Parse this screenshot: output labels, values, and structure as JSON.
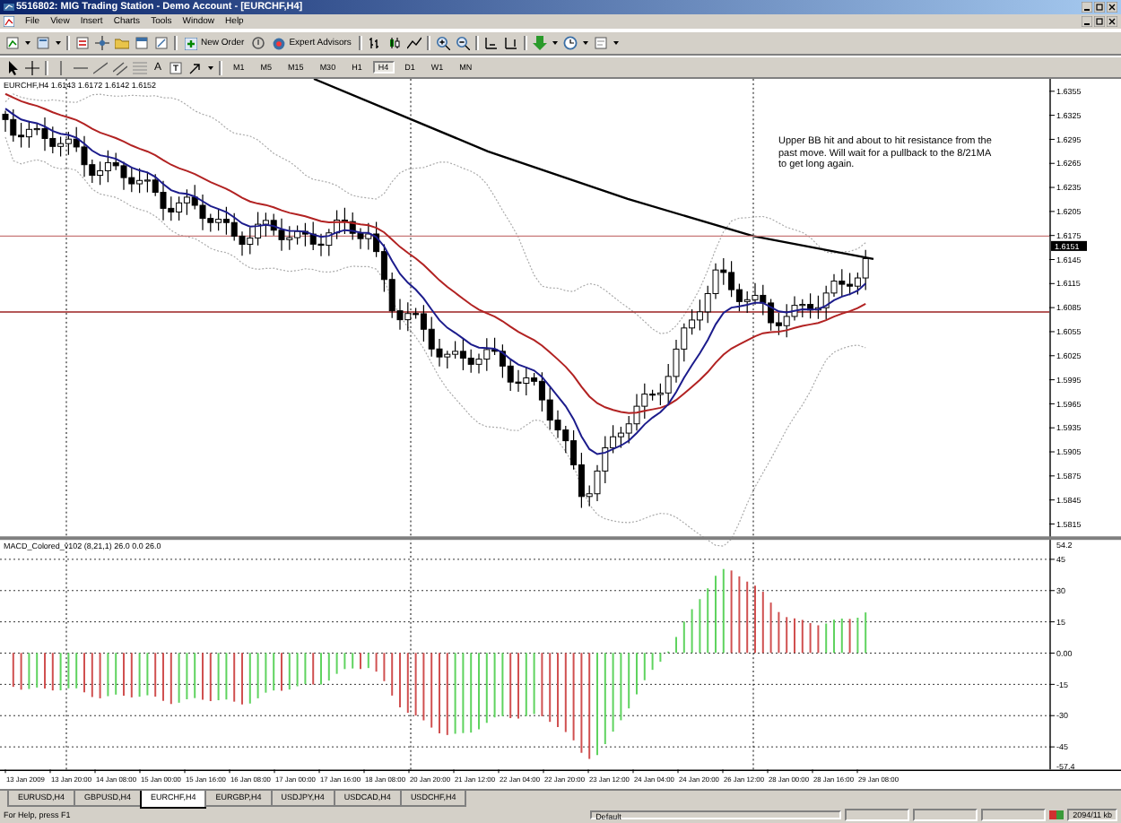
{
  "window": {
    "title": "5516802: MIG Trading Station - Demo Account - [EURCHF,H4]"
  },
  "menu": [
    "File",
    "View",
    "Insert",
    "Charts",
    "Tools",
    "Window",
    "Help"
  ],
  "toolbar": {
    "buttons": [
      {
        "label": "New Order"
      },
      {
        "label": "Expert Advisors"
      }
    ],
    "text_tool": "A",
    "timeframes": [
      {
        "label": "M1",
        "selected": false
      },
      {
        "label": "M5",
        "selected": false
      },
      {
        "label": "M15",
        "selected": false
      },
      {
        "label": "M30",
        "selected": false
      },
      {
        "label": "H1",
        "selected": false
      },
      {
        "label": "H4",
        "selected": true
      },
      {
        "label": "D1",
        "selected": false
      },
      {
        "label": "W1",
        "selected": false
      },
      {
        "label": "MN",
        "selected": false
      }
    ]
  },
  "chart": {
    "symbol_label": "EURCHF,H4 1.6143 1.6172 1.6142 1.6152",
    "annotation": "Upper BB hit and about to hit resistance from the past move. Will wait for a pullback to the 8/21MA to get long again.",
    "price_ticks": [
      "1.6355",
      "1.6325",
      "1.6295",
      "1.6265",
      "1.6235",
      "1.6205",
      "1.6175",
      "1.6145",
      "1.6115",
      "1.6085",
      "1.6055",
      "1.6025",
      "1.5995",
      "1.5965",
      "1.5935",
      "1.5905",
      "1.5875",
      "1.5845",
      "1.5815"
    ],
    "current_price": "1.6151",
    "indicator_label": "MACD_Colored_v102 (8,21,1) 26.0 0.0 26.0",
    "indicator_ticks": [
      "54.2",
      "45",
      "30",
      "15",
      "0.00",
      "-15",
      "-30",
      "-45",
      "-57.4"
    ],
    "time_ticks": [
      "13 Jan 2009",
      "13 Jan 20:00",
      "14 Jan 08:00",
      "15 Jan 00:00",
      "15 Jan 16:00",
      "16 Jan 08:00",
      "17 Jan 00:00",
      "17 Jan 16:00",
      "18 Jan 08:00",
      "20 Jan 20:00",
      "21 Jan 12:00",
      "22 Jan 04:00",
      "22 Jan 20:00",
      "23 Jan 12:00",
      "24 Jan 04:00",
      "24 Jan 20:00",
      "26 Jan 12:00",
      "28 Jan 00:00",
      "28 Jan 16:00",
      "29 Jan 08:00"
    ]
  },
  "tabs": [
    {
      "label": "EURUSD,H4",
      "selected": false
    },
    {
      "label": "GBPUSD,H4",
      "selected": false
    },
    {
      "label": "EURCHF,H4",
      "selected": true
    },
    {
      "label": "EURGBP,H4",
      "selected": false
    },
    {
      "label": "USDJPY,H4",
      "selected": false
    },
    {
      "label": "USDCAD,H4",
      "selected": false
    },
    {
      "label": "USDCHF,H4",
      "selected": false
    }
  ],
  "status_bar": {
    "help": "For Help, press F1",
    "profile": "Default",
    "traffic": "2094/11 kb"
  }
}
